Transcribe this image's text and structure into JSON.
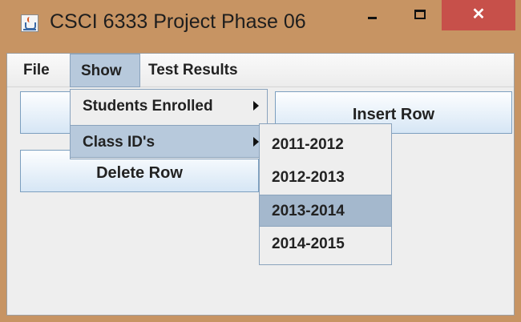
{
  "window": {
    "title": "CSCI 6333 Project Phase 06",
    "close_glyph": "✕"
  },
  "menubar": {
    "items": [
      "File",
      "Show",
      "Test Results"
    ]
  },
  "buttons": {
    "left_top_label": "",
    "insert_label": "Insert Row",
    "delete_label": "Delete Row"
  },
  "show_menu": {
    "items": [
      "Students Enrolled",
      "Class ID's"
    ],
    "highlighted": "Class ID's"
  },
  "class_ids_submenu": {
    "items": [
      "2011-2012",
      "2012-2013",
      "2013-2014",
      "2014-2015"
    ],
    "highlighted": "2013-2014"
  },
  "icons": {
    "app": "java-cup-icon",
    "minimize": "minimize-icon",
    "maximize": "maximize-icon",
    "close": "close-icon",
    "submenu_arrow": "chevron-right-icon"
  },
  "colors": {
    "frame": "#c79463",
    "close_button": "#c7504a",
    "menu_highlight": "#b7c9dc",
    "content_background": "#eeeeee"
  }
}
